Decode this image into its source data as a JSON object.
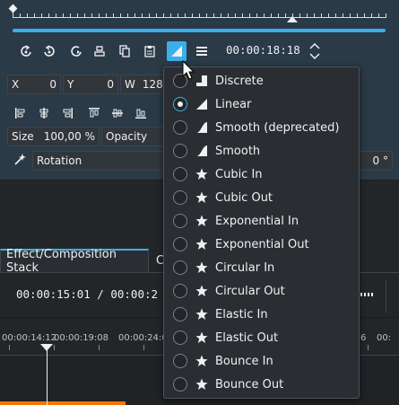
{
  "keyframe_panel": {
    "timecode": "00:00:18:18",
    "position_fields": [
      {
        "label": "X",
        "value": "0"
      },
      {
        "label": "Y",
        "value": "0"
      },
      {
        "label": "W",
        "value": "128"
      }
    ],
    "size": {
      "label": "Size",
      "value": "100,00 %"
    },
    "opacity": {
      "label": "Opacity"
    },
    "rotation": {
      "label": "Rotation",
      "value": "0 °"
    }
  },
  "interpolation_menu": {
    "selected": "Linear",
    "items": [
      {
        "label": "Discrete",
        "icon": "discrete-icon",
        "checked": false
      },
      {
        "label": "Linear",
        "icon": "linear-icon",
        "checked": true
      },
      {
        "label": "Smooth (deprecated)",
        "icon": "smooth-icon",
        "checked": false
      },
      {
        "label": "Smooth",
        "icon": "smooth-icon",
        "checked": false
      },
      {
        "label": "Cubic In",
        "icon": "star-icon",
        "checked": false
      },
      {
        "label": "Cubic Out",
        "icon": "star-icon",
        "checked": false
      },
      {
        "label": "Exponential In",
        "icon": "star-icon",
        "checked": false
      },
      {
        "label": "Exponential Out",
        "icon": "star-icon",
        "checked": false
      },
      {
        "label": "Circular In",
        "icon": "star-icon",
        "checked": false
      },
      {
        "label": "Circular Out",
        "icon": "star-icon",
        "checked": false
      },
      {
        "label": "Elastic In",
        "icon": "star-icon",
        "checked": false
      },
      {
        "label": "Elastic Out",
        "icon": "star-icon",
        "checked": false
      },
      {
        "label": "Bounce In",
        "icon": "star-icon",
        "checked": false
      },
      {
        "label": "Bounce Out",
        "icon": "star-icon",
        "checked": false
      }
    ]
  },
  "tabs": [
    {
      "label": "Effect/Composition Stack",
      "active": true
    },
    {
      "label": "C",
      "active": false
    }
  ],
  "monitor": {
    "timecode": "00:00:15:01 / 00:00:2"
  },
  "timeline_ruler": {
    "labels": [
      "00:00:14:12",
      "00:00:19:08",
      "00:00:24:0",
      "6",
      "00:"
    ]
  },
  "colors": {
    "accent": "#3daee9",
    "panel": "#2a3a47",
    "background": "#232629",
    "clip_strip": "#f67400"
  }
}
